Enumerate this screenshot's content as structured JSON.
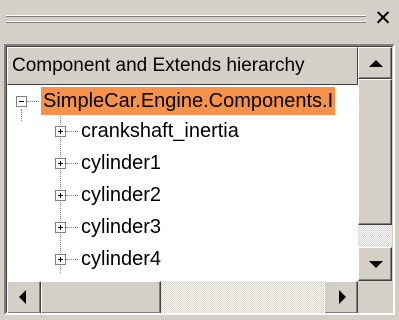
{
  "window": {
    "close_glyph": "✕"
  },
  "header": {
    "title": "Component and Extends hierarchy"
  },
  "tree": {
    "root": {
      "label": "SimpleCar.Engine.Components.I",
      "expanded": true,
      "selected": true
    },
    "children": [
      {
        "label": "crankshaft_inertia",
        "expanded": false
      },
      {
        "label": "cylinder1",
        "expanded": false
      },
      {
        "label": "cylinder2",
        "expanded": false
      },
      {
        "label": "cylinder3",
        "expanded": false
      },
      {
        "label": "cylinder4",
        "expanded": false
      }
    ]
  },
  "colors": {
    "selection": "#f7924a",
    "face": "#d4d0c8"
  },
  "icons": {
    "close": "close-icon",
    "expand": "plus-box-icon",
    "collapse": "minus-box-icon",
    "scroll_up": "arrow-up-icon",
    "scroll_down": "arrow-down-icon",
    "scroll_left": "arrow-left-icon",
    "scroll_right": "arrow-right-icon"
  }
}
